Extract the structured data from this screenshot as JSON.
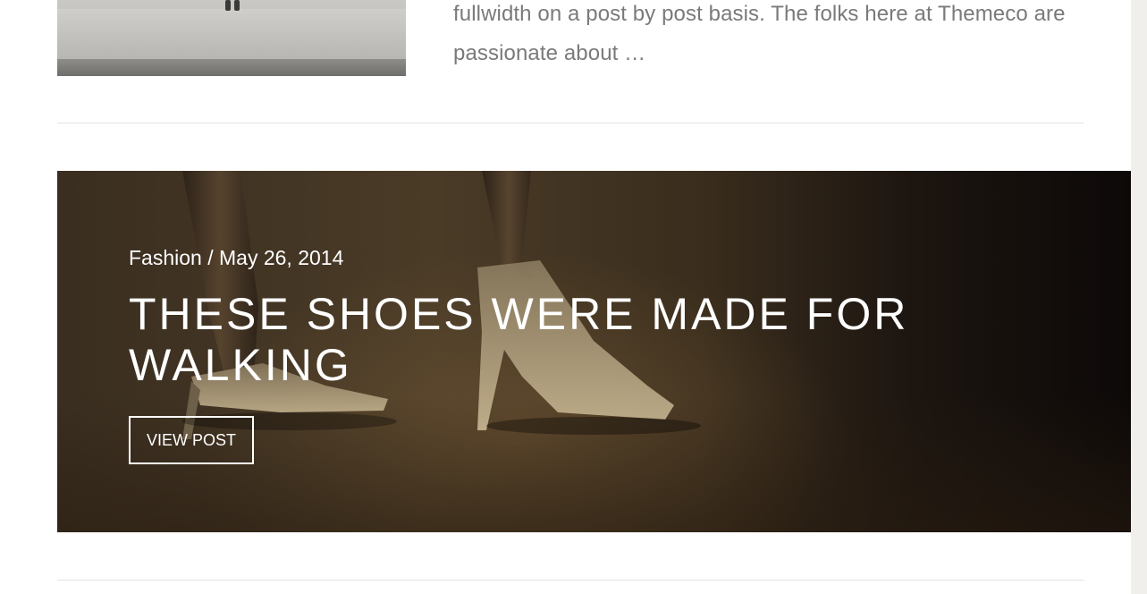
{
  "previous_post": {
    "excerpt_lines": [
      "fullwidth on a post by post basis. The folks here at Themeco are",
      "passionate about …"
    ]
  },
  "featured_post": {
    "category": "Fashion",
    "separator": " / ",
    "date": "May 26, 2014",
    "title_lines": [
      "THESE SHOES WERE MADE FOR",
      "WALKING"
    ],
    "button_label": "VIEW POST"
  },
  "colors": {
    "excerpt_text": "#7a7a7a",
    "divider": "#e3e3e3",
    "banner_text": "#ffffff"
  }
}
